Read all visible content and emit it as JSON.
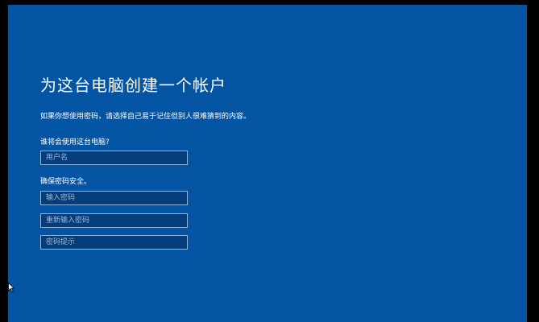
{
  "setup": {
    "title": "为这台电脑创建一个帐户",
    "subtitle": "如果你想使用密码，请选择自己易于记住但别人很难猜到的内容。",
    "who_label": "谁将会使用这台电脑?",
    "username_placeholder": "用户名",
    "security_label": "确保密码安全。",
    "password_placeholder": "输入密码",
    "reenter_placeholder": "重新输入密码",
    "hint_placeholder": "密码提示"
  },
  "colors": {
    "background": "#0454a4",
    "field_bg": "#043c7c",
    "field_border": "#8fb3d9",
    "text": "#ffffff"
  }
}
